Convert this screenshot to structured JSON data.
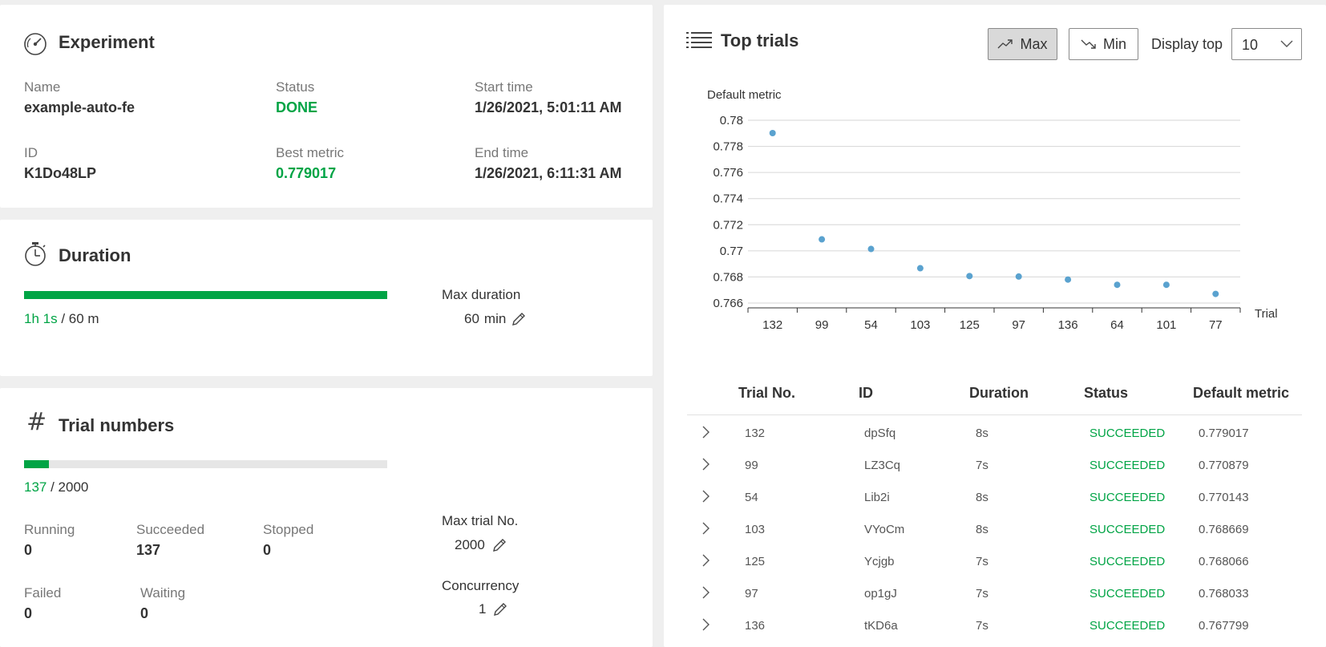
{
  "experiment": {
    "title": "Experiment",
    "name_label": "Name",
    "name_value": "example-auto-fe",
    "status_label": "Status",
    "status_value": "DONE",
    "start_label": "Start time",
    "start_value": "1/26/2021, 5:01:11 AM",
    "id_label": "ID",
    "id_value": "K1Do48LP",
    "best_label": "Best metric",
    "best_value": "0.779017",
    "end_label": "End time",
    "end_value": "1/26/2021, 6:11:31 AM"
  },
  "duration": {
    "title": "Duration",
    "elapsed": "1h 1s",
    "total": "/ 60 m",
    "progress": 1.0,
    "max_label": "Max duration",
    "max_value": "60",
    "max_unit": "min"
  },
  "trials": {
    "title": "Trial numbers",
    "done": "137",
    "total": "/ 2000",
    "progress": 0.0685,
    "running_label": "Running",
    "running_value": "0",
    "succeeded_label": "Succeeded",
    "succeeded_value": "137",
    "stopped_label": "Stopped",
    "stopped_value": "0",
    "failed_label": "Failed",
    "failed_value": "0",
    "waiting_label": "Waiting",
    "waiting_value": "0",
    "max_label": "Max trial No.",
    "max_value": "2000",
    "conc_label": "Concurrency",
    "conc_value": "1"
  },
  "top": {
    "title": "Top trials",
    "max_btn": "Max",
    "min_btn": "Min",
    "display_label": "Display top",
    "display_value": "10"
  },
  "chart_data": {
    "type": "scatter",
    "ylabel": "Default metric",
    "xlabel": "Trial",
    "categories": [
      "132",
      "99",
      "54",
      "103",
      "125",
      "97",
      "136",
      "64",
      "101",
      "77"
    ],
    "values": [
      0.779017,
      0.770879,
      0.770143,
      0.768669,
      0.768066,
      0.768033,
      0.767799,
      0.7674,
      0.7674,
      0.7667
    ],
    "ylim": [
      0.766,
      0.78
    ],
    "yticks": [
      "0.78",
      "0.778",
      "0.776",
      "0.774",
      "0.772",
      "0.77",
      "0.768",
      "0.766"
    ],
    "grid": true,
    "point_color": "#5aa2cf"
  },
  "table": {
    "headers": [
      "Trial No.",
      "ID",
      "Duration",
      "Status",
      "Default metric"
    ],
    "rows": [
      {
        "no": "132",
        "id": "dpSfq",
        "dur": "8s",
        "status": "SUCCEEDED",
        "metric": "0.779017"
      },
      {
        "no": "99",
        "id": "LZ3Cq",
        "dur": "7s",
        "status": "SUCCEEDED",
        "metric": "0.770879"
      },
      {
        "no": "54",
        "id": "Lib2i",
        "dur": "8s",
        "status": "SUCCEEDED",
        "metric": "0.770143"
      },
      {
        "no": "103",
        "id": "VYoCm",
        "dur": "8s",
        "status": "SUCCEEDED",
        "metric": "0.768669"
      },
      {
        "no": "125",
        "id": "Ycjgb",
        "dur": "7s",
        "status": "SUCCEEDED",
        "metric": "0.768066"
      },
      {
        "no": "97",
        "id": "op1gJ",
        "dur": "7s",
        "status": "SUCCEEDED",
        "metric": "0.768033"
      },
      {
        "no": "136",
        "id": "tKD6a",
        "dur": "7s",
        "status": "SUCCEEDED",
        "metric": "0.767799"
      }
    ]
  }
}
